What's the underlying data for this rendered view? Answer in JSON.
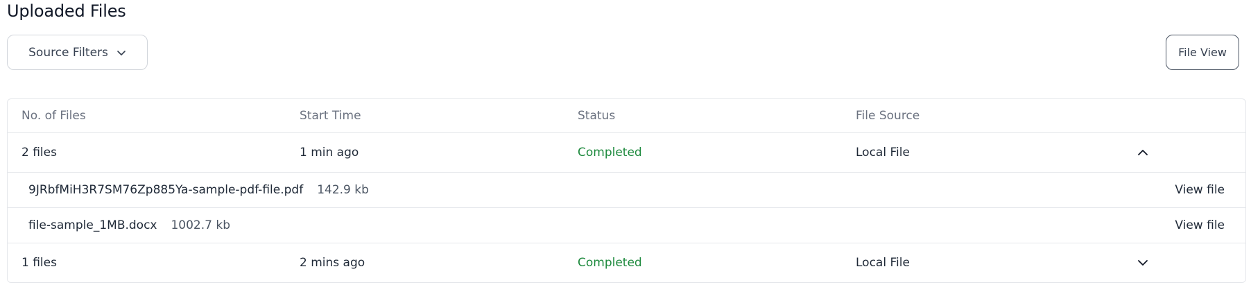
{
  "page": {
    "title": "Uploaded Files"
  },
  "toolbar": {
    "filter_label": "Source Filters",
    "view_label": "File View"
  },
  "table": {
    "columns": [
      "No. of Files",
      "Start Time",
      "Status",
      "File Source"
    ],
    "groups": [
      {
        "count": "2 files",
        "start_time": "1 min ago",
        "status": "Completed",
        "source": "Local File",
        "expanded": true,
        "toggle_icon": "chevron-up-icon",
        "files": [
          {
            "name": "9JRbfMiH3R7SM76Zp885Ya-sample-pdf-file.pdf",
            "size": "142.9 kb",
            "action": "View file"
          },
          {
            "name": "file-sample_1MB.docx",
            "size": "1002.7 kb",
            "action": "View file"
          }
        ]
      },
      {
        "count": "1 files",
        "start_time": "2 mins ago",
        "status": "Completed",
        "source": "Local File",
        "expanded": false,
        "toggle_icon": "chevron-down-icon"
      }
    ]
  },
  "colors": {
    "status_completed": "#1e8a3e",
    "border": "#e5e7eb",
    "muted_text": "#6b7280"
  }
}
